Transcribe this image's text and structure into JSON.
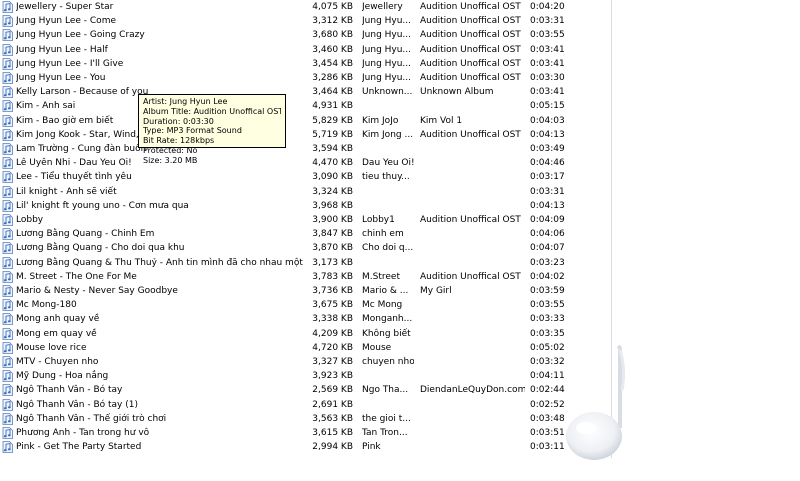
{
  "file_list": {
    "rows": [
      {
        "name": "Jewellery - Super Star",
        "size": "4,075 KB",
        "artist": "Jewellery",
        "album": "Audition Unoffical OST",
        "duration": "0:04:20"
      },
      {
        "name": "Jung Hyun Lee - Come",
        "size": "3,312 KB",
        "artist": "Jung Hyu...",
        "album": "Audition Unoffical OST",
        "duration": "0:03:31"
      },
      {
        "name": "Jung Hyun Lee - Going Crazy",
        "size": "3,680 KB",
        "artist": "Jung Hyu...",
        "album": "Audition Unoffical OST",
        "duration": "0:03:55"
      },
      {
        "name": "Jung Hyun Lee - Half",
        "size": "3,460 KB",
        "artist": "Jung Hyu...",
        "album": "Audition Unoffical OST",
        "duration": "0:03:41"
      },
      {
        "name": "Jung Hyun Lee - I'll Give",
        "size": "3,454 KB",
        "artist": "Jung Hyu...",
        "album": "Audition Unoffical OST",
        "duration": "0:03:41"
      },
      {
        "name": "Jung Hyun Lee - You",
        "size": "3,286 KB",
        "artist": "Jung Hyu...",
        "album": "Audition Unoffical OST",
        "duration": "0:03:30"
      },
      {
        "name": "Kelly Larson - Because of you",
        "size": "3,464 KB",
        "artist": "Unknown...",
        "album": "Unknown Album",
        "duration": "0:03:41"
      },
      {
        "name": "Kim - Anh sai",
        "size": "4,931 KB",
        "artist": "",
        "album": "",
        "duration": "0:05:15"
      },
      {
        "name": "Kim - Bao giờ em biết",
        "size": "5,829 KB",
        "artist": "Kim JoJo",
        "album": "Kim Vol 1",
        "duration": "0:04:03"
      },
      {
        "name": "Kim Jong Kook - Star, Wind, Sun",
        "size": "5,719 KB",
        "artist": "Kim Jong ...",
        "album": "Audition Unoffical OST",
        "duration": "0:04:13"
      },
      {
        "name": "Lam Trường - Cung đàn buồn",
        "size": "3,594 KB",
        "artist": "",
        "album": "",
        "duration": "0:03:49"
      },
      {
        "name": "Lê Uyên Nhi - Dau Yeu Oi!",
        "size": "4,470 KB",
        "artist": "Dau Yeu Oi!",
        "album": "",
        "duration": "0:04:46"
      },
      {
        "name": "Lee - Tiểu thuyết tình yêu",
        "size": "3,090 KB",
        "artist": "tieu thuy...",
        "album": "",
        "duration": "0:03:17"
      },
      {
        "name": "Lil knight - Anh sẽ viết",
        "size": "3,324 KB",
        "artist": "",
        "album": "",
        "duration": "0:03:31"
      },
      {
        "name": "Lil' knight ft young uno - Cơn mưa qua",
        "size": "3,968 KB",
        "artist": "",
        "album": "",
        "duration": "0:04:13"
      },
      {
        "name": "Lobby",
        "size": "3,900 KB",
        "artist": "Lobby1",
        "album": "Audition Unoffical OST",
        "duration": "0:04:09"
      },
      {
        "name": "Lương Bằng Quang - Chinh Em",
        "size": "3,847 KB",
        "artist": "chinh em",
        "album": "",
        "duration": "0:04:06"
      },
      {
        "name": "Lương Bằng Quang - Cho doi qua khu",
        "size": "3,870 KB",
        "artist": "Cho doi q...",
        "album": "",
        "duration": "0:04:07"
      },
      {
        "name": "Lương Bằng Quang & Thu Thuỷ - Anh tin mình đã cho nhau một kỉ niệm",
        "size": "3,173 KB",
        "artist": "",
        "album": "",
        "duration": "0:03:23"
      },
      {
        "name": "M. Street - The One For Me",
        "size": "3,783 KB",
        "artist": "M.Street",
        "album": "Audition Unoffical OST",
        "duration": "0:04:02"
      },
      {
        "name": "Mario & Nesty - Never Say Goodbye",
        "size": "3,736 KB",
        "artist": "Mario & ...",
        "album": "My Girl",
        "duration": "0:03:59"
      },
      {
        "name": "Mc Mong-180",
        "size": "3,675 KB",
        "artist": "Mc Mong",
        "album": "",
        "duration": "0:03:55"
      },
      {
        "name": "Mong anh quay về",
        "size": "3,338 KB",
        "artist": "Monganh...",
        "album": "",
        "duration": "0:03:33"
      },
      {
        "name": "Mong em quay về",
        "size": "4,209 KB",
        "artist": "Không biết",
        "album": "",
        "duration": "0:03:35"
      },
      {
        "name": "Mouse love rice",
        "size": "4,720 KB",
        "artist": "Mouse",
        "album": "",
        "duration": "0:05:02"
      },
      {
        "name": "MTV - Chuyen nho",
        "size": "3,327 KB",
        "artist": "chuyen nho",
        "album": "",
        "duration": "0:03:32"
      },
      {
        "name": "Mỹ Dung - Hoa nắng",
        "size": "3,923 KB",
        "artist": "",
        "album": "",
        "duration": "0:04:11"
      },
      {
        "name": "Ngô Thanh Vân - Bó tay",
        "size": "2,569 KB",
        "artist": "Ngo Tha...",
        "album": "DiendanLeQuyDon.com",
        "duration": "0:02:44"
      },
      {
        "name": "Ngô Thanh Vân - Bó tay (1)",
        "size": "2,691 KB",
        "artist": "",
        "album": "",
        "duration": "0:02:52"
      },
      {
        "name": "Ngô Thanh Vân - Thế giới trò chơi",
        "size": "3,563 KB",
        "artist": "the gioi t...",
        "album": "",
        "duration": "0:03:48"
      },
      {
        "name": "Phương Anh - Tan trong hư vô",
        "size": "3,615 KB",
        "artist": "Tan Tron...",
        "album": "",
        "duration": "0:03:51"
      },
      {
        "name": "Pink - Get The Party Started",
        "size": "2,994 KB",
        "artist": "Pink",
        "album": "",
        "duration": "0:03:11"
      }
    ]
  },
  "tooltip": {
    "artist": "Artist: Jung Hyun Lee",
    "album": "Album Title: Audition Unoffical OST",
    "duration": "Duration: 0:03:30",
    "type": "Type: MP3 Format Sound",
    "bitrate": "Bit Rate: 128kbps",
    "protected": "Protected: No",
    "size": "Size: 3.20 MB"
  },
  "icons": {
    "file": "mp3-file-icon",
    "decor": "music-note-orb-icon"
  },
  "colors": {
    "tooltip_bg": "#ffffe1",
    "icon_blue": "#3a6fc4"
  }
}
